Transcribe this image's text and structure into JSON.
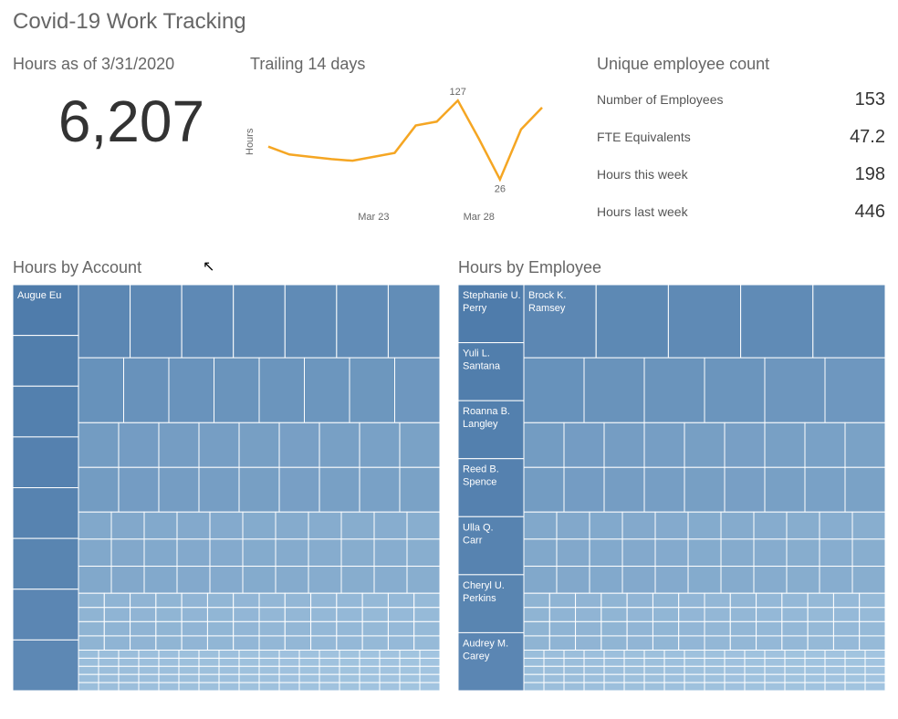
{
  "title": "Covid-19 Work Tracking",
  "kpi": {
    "title": "Hours as of 3/31/2020",
    "value": "6,207"
  },
  "stats": {
    "title": "Unique employee count",
    "rows": [
      {
        "label": "Number of Employees",
        "value": "153"
      },
      {
        "label": "FTE Equivalents",
        "value": "47.2"
      },
      {
        "label": "Hours this week",
        "value": "198"
      },
      {
        "label": "Hours last week",
        "value": "446"
      }
    ]
  },
  "treemaps": {
    "account": {
      "title": "Hours by Account",
      "items": [
        "Augue Eu"
      ]
    },
    "employee": {
      "title": "Hours by Employee",
      "items": [
        "Stephanie U. Perry",
        "Brock K. Ramsey",
        "Yuli L. Santana",
        "Roanna B. Langley",
        "Reed B. Spence",
        "Ulla Q. Carr",
        "Cheryl U. Perkins",
        "Audrey M. Carey"
      ]
    }
  },
  "chart_data": {
    "type": "line",
    "title": "Trailing 14 days",
    "ylabel": "Hours",
    "x_ticks": [
      "Mar 23",
      "Mar 28"
    ],
    "annotations": [
      {
        "index": 9,
        "value": 127,
        "label": "127"
      },
      {
        "index": 11,
        "value": 26,
        "label": "26"
      }
    ],
    "x": [
      0,
      1,
      2,
      3,
      4,
      5,
      6,
      7,
      8,
      9,
      10,
      11,
      12,
      13
    ],
    "values": [
      68,
      58,
      55,
      52,
      50,
      55,
      60,
      95,
      100,
      127,
      78,
      26,
      90,
      118
    ],
    "ylim": [
      0,
      140
    ],
    "color": "#f5a623"
  }
}
